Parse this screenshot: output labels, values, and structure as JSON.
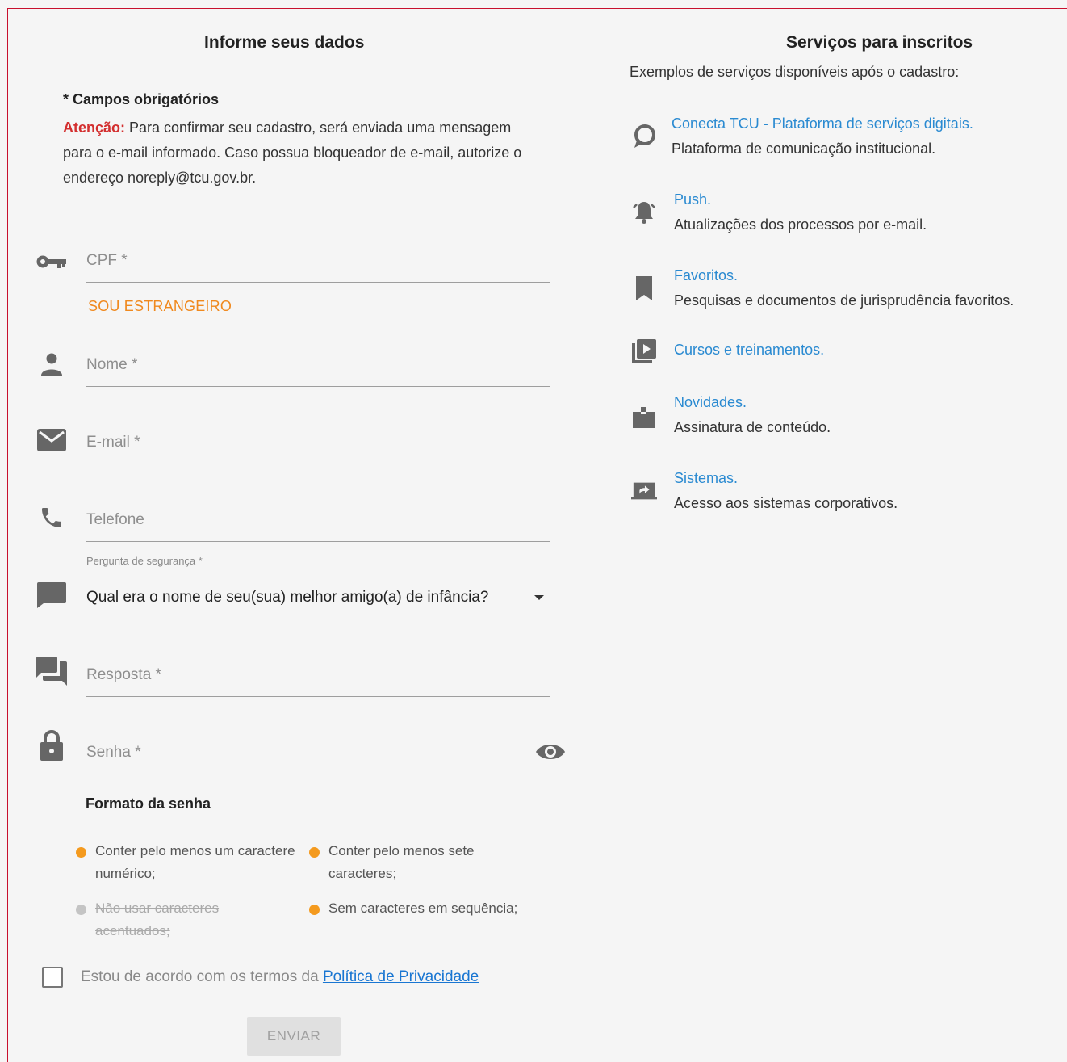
{
  "form": {
    "title": "Informe seus dados",
    "required_note": "* Campos obrigatórios",
    "attention_label": "Atenção:",
    "attention_text": " Para confirmar seu cadastro, será enviada uma mensagem para o e-mail informado. Caso possua bloqueador de e-mail, autorize o endereço noreply@tcu.gov.br.",
    "cpf_placeholder": "CPF *",
    "foreign_link": "SOU ESTRANGEIRO",
    "name_placeholder": "Nome *",
    "email_placeholder": "E-mail *",
    "phone_placeholder": "Telefone",
    "security_question_label": "Pergunta de segurança *",
    "security_question_value": "Qual era o nome de seu(sua) melhor amigo(a) de infância?",
    "answer_placeholder": "Resposta *",
    "password_placeholder": "Senha *",
    "password_format_title": "Formato da senha",
    "rules": [
      {
        "text": "Conter pelo menos um caractere numérico;",
        "satisfied": false
      },
      {
        "text": "Conter pelo menos sete caracteres;",
        "satisfied": false
      },
      {
        "text": "Não usar caracteres acentuados;",
        "satisfied": true
      },
      {
        "text": "Sem caracteres em sequência;",
        "satisfied": false
      }
    ],
    "agree_text": "Estou de acordo com os termos da ",
    "agree_link": "Política de Privacidade",
    "submit_label": "ENVIAR"
  },
  "services": {
    "title": "Serviços para inscritos",
    "intro": "Exemplos de serviços disponíveis após o cadastro:",
    "items": [
      {
        "icon": "chat-bubble-icon",
        "title": "Conecta TCU - Plataforma de serviços digitais.",
        "desc": "Plataforma de comunicação institucional."
      },
      {
        "icon": "bell-icon",
        "title": "Push.",
        "desc": "Atualizações dos processos por e-mail."
      },
      {
        "icon": "bookmark-icon",
        "title": "Favoritos.",
        "desc": "Pesquisas e documentos de jurisprudência favoritos."
      },
      {
        "icon": "video-library-icon",
        "title": "Cursos e treinamentos.",
        "desc": ""
      },
      {
        "icon": "news-icon",
        "title": "Novidades.",
        "desc": "Assinatura de conteúdo."
      },
      {
        "icon": "systems-icon",
        "title": "Sistemas.",
        "desc": "Acesso aos sistemas corporativos."
      }
    ]
  },
  "colors": {
    "accent_orange": "#f0891e",
    "link_blue": "#2a8ad1",
    "warning_red": "#d32f2f",
    "frame_red": "#c8102e"
  }
}
